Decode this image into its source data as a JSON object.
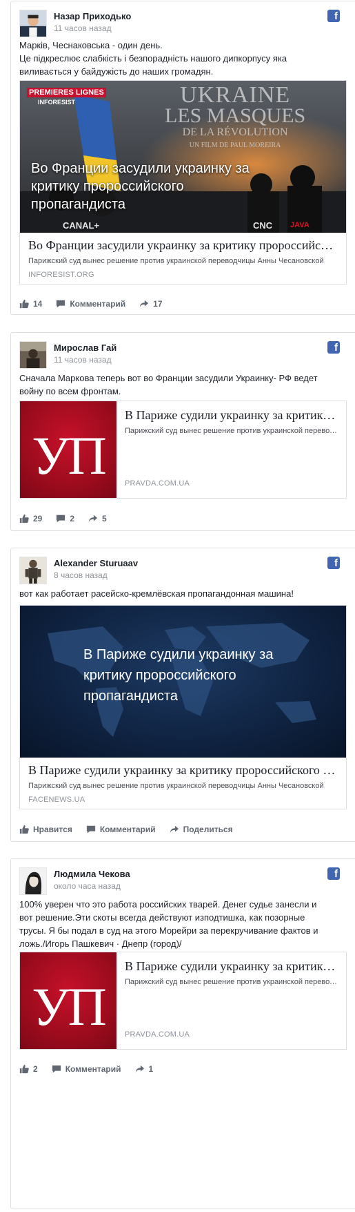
{
  "posts": [
    {
      "author": "Назар Приходько",
      "time": "11 часов назад",
      "text": [
        "Марків, Чеснаковська - один день.",
        "Це підкреслює слабкість і безпорадність нашого дипкорпусу яка",
        "виливається у байдужість до наших громадян."
      ],
      "card": {
        "image_overlay": [
          "Во Франции засудили украинку за",
          "критику пророссийского",
          "пропагандиста"
        ],
        "image_brand_top": "PREMIERES LIGNES",
        "image_brand_sub": "INFORESIST",
        "image_film_title": [
          "UKRAINE",
          "LES MASQUES",
          "DE LA RÉVOLUTION"
        ],
        "image_film_credit": "UN FILM DE PAUL MOREIRA",
        "image_canal": "CANAL+",
        "image_cnc": "CNC",
        "image_java": "JAVA",
        "title": "Во Франции засудили украинку за критику пророссийского пропагандиста",
        "description": "Парижский суд вынес решение против украинской переводчицы Анны Чесановской",
        "domain": "INFORESIST.ORG"
      },
      "actions": {
        "likes": "14",
        "comment": "Комментарий",
        "shares": "17"
      }
    },
    {
      "author": "Мирослав Гай",
      "time": "11 часов назад",
      "text": [
        "Сначала Маркова теперь вот во Франции засудили Украинку- РФ ведет",
        "войну по всем фронтам."
      ],
      "card": {
        "logo": "УП",
        "title": "В Париже судили украинку за критику пророссийского пропагандиста",
        "description": "Парижский суд вынес решение против украинской переводчицы",
        "domain": "PRAVDA.COM.UA"
      },
      "actions": {
        "likes": "29",
        "comments": "2",
        "shares": "5"
      }
    },
    {
      "author": "Alexander Sturuaav",
      "time": "8 часов назад",
      "text": [
        "вот как работает расейско-кремлёвская пропагандонная машина!"
      ],
      "card": {
        "image_overlay": [
          "В Париже судили украинку за",
          "критику пророссийского",
          "пропагандиста"
        ],
        "title": "В Париже судили украинку за критику пророссийского пропагандиста",
        "description": "Парижский суд вынес решение против украинской переводчицы Анны Чесановской",
        "domain": "FACENEWS.UA"
      },
      "actions": {
        "like": "Нравится",
        "comment": "Комментарий",
        "share": "Поделиться"
      }
    },
    {
      "author": "Людмила Чекова",
      "time": "около часа назад",
      "text": [
        "100% уверен что это работа российских тварей. Денег судье занесли и",
        "вот решение.Эти скоты всегда действуют изподтишка, как позорные",
        "трусы. Я бы подал в суд на этого Морейри за перекручивание фактов и",
        "ложь./Игорь Пашкевич · Днепр (город)/"
      ],
      "card": {
        "logo": "УП",
        "title": "В Париже судили украинку за критику пророссийского пропагандиста",
        "description": "Парижский суд вынес решение против украинской переводчицы",
        "domain": "PRAVDA.COM.UA"
      },
      "actions": {
        "likes": "2",
        "comment": "Комментарий",
        "shares": "1"
      }
    }
  ],
  "icons": {
    "facebook": "f"
  },
  "colors": {
    "facebook_blue": "#4267b2",
    "up_red": "#b30f22",
    "map_navy": "#0f2240"
  }
}
